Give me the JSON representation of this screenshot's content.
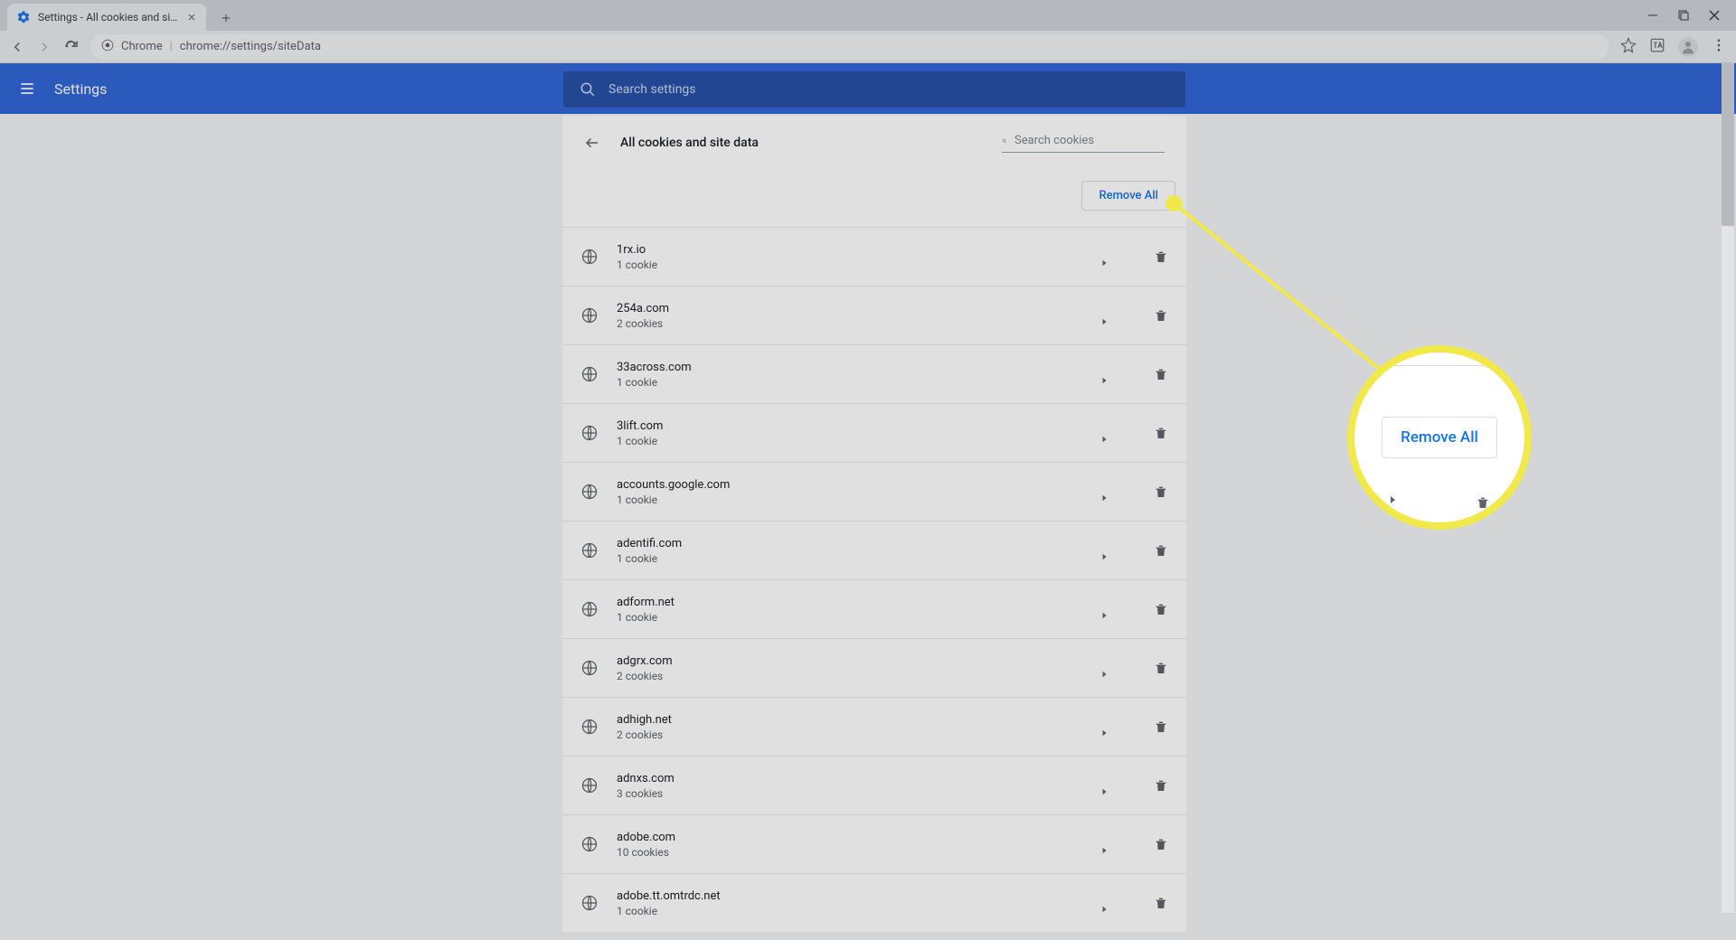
{
  "browser": {
    "tab_title": "Settings - All cookies and site da",
    "address_label": "Chrome",
    "address_url": "chrome://settings/siteData"
  },
  "header": {
    "app_name": "Settings",
    "search_placeholder": "Search settings"
  },
  "panel": {
    "title": "All cookies and site data",
    "search_placeholder": "Search cookies",
    "remove_all_label": "Remove All"
  },
  "sites": [
    {
      "domain": "1rx.io",
      "count": "1 cookie"
    },
    {
      "domain": "254a.com",
      "count": "2 cookies"
    },
    {
      "domain": "33across.com",
      "count": "1 cookie"
    },
    {
      "domain": "3lift.com",
      "count": "1 cookie"
    },
    {
      "domain": "accounts.google.com",
      "count": "1 cookie"
    },
    {
      "domain": "adentifi.com",
      "count": "1 cookie"
    },
    {
      "domain": "adform.net",
      "count": "1 cookie"
    },
    {
      "domain": "adgrx.com",
      "count": "2 cookies"
    },
    {
      "domain": "adhigh.net",
      "count": "2 cookies"
    },
    {
      "domain": "adnxs.com",
      "count": "3 cookies"
    },
    {
      "domain": "adobe.com",
      "count": "10 cookies"
    },
    {
      "domain": "adobe.tt.omtrdc.net",
      "count": "1 cookie"
    }
  ],
  "callout": {
    "label": "Remove All"
  }
}
